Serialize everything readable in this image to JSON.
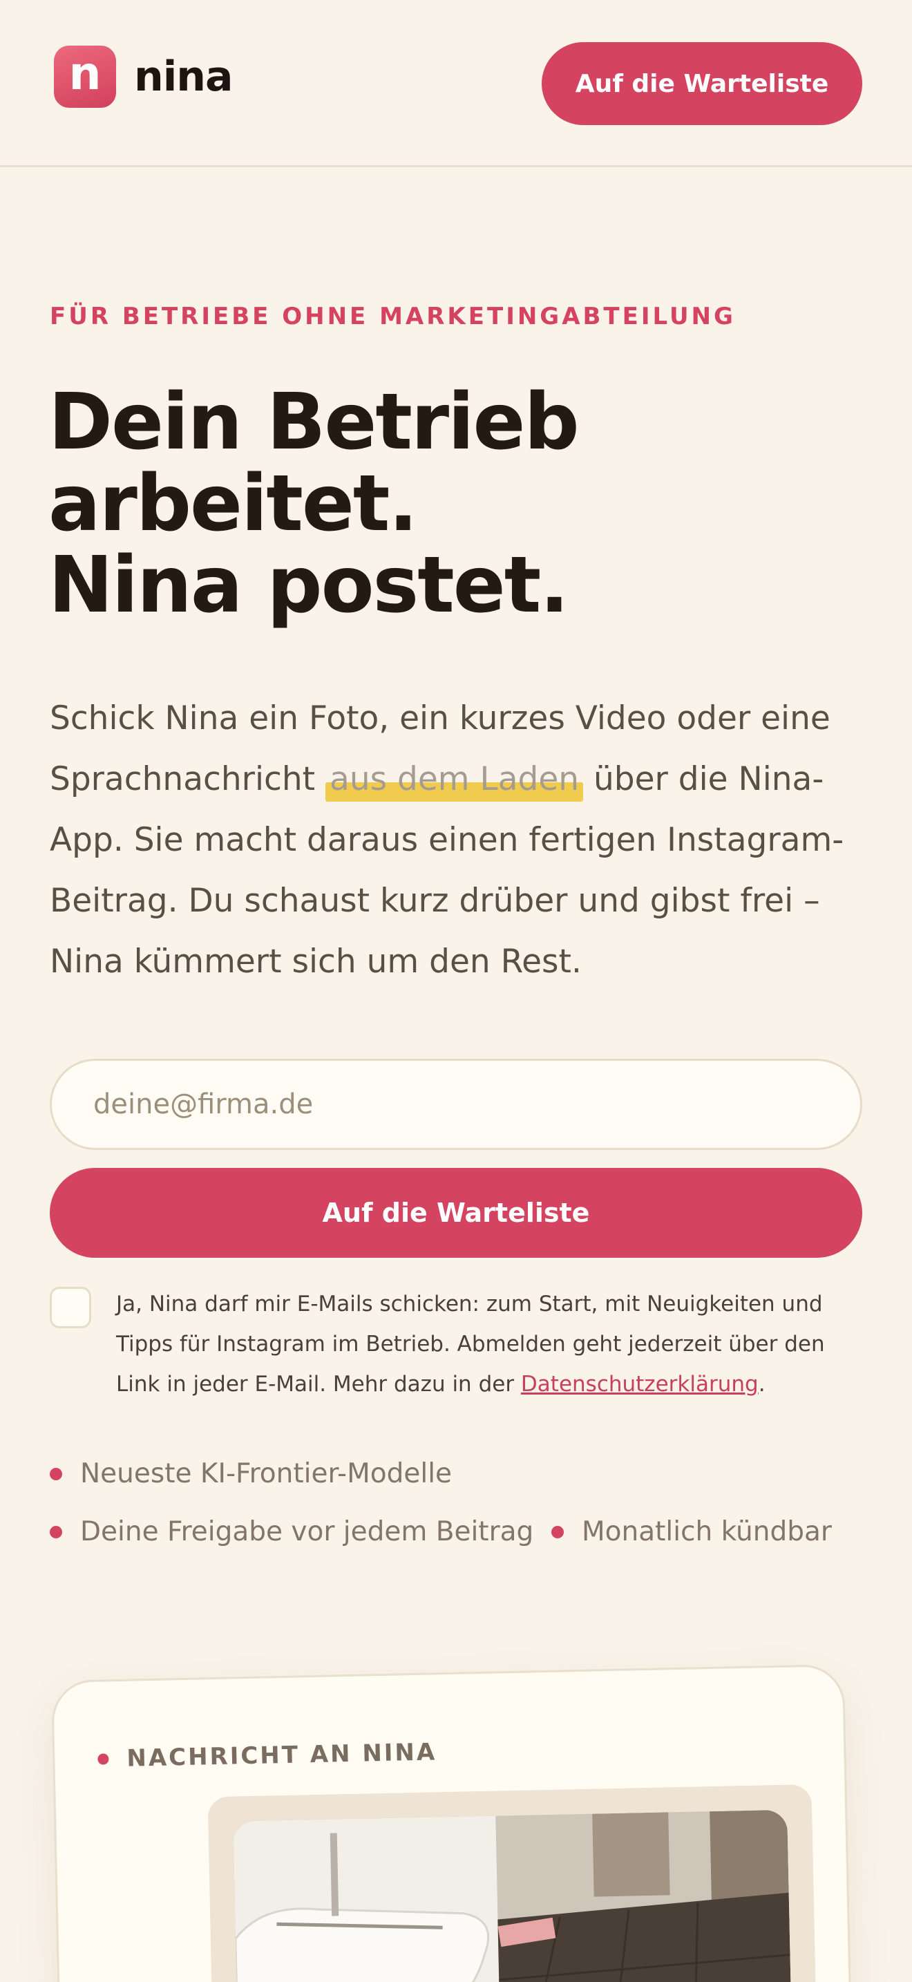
{
  "header": {
    "logo_letter": "n",
    "logo_text": "nina",
    "cta_label": "Auf die Warteliste"
  },
  "hero": {
    "eyebrow": "FÜR BETRIEBE OHNE MARKETINGABTEILUNG",
    "headline": [
      "Dein Betrieb",
      "arbeitet.",
      "Nina postet."
    ],
    "lede_before": "Schick Nina ein Foto, ein kurzes Video oder eine Sprachnachricht ",
    "lede_highlight": "aus dem Laden",
    "lede_after": " über die Nina-App. Sie macht daraus einen fertigen Instagram-Beitrag. Du schaust kurz drüber und gibst frei – Nina kümmert sich um den Rest."
  },
  "signup": {
    "email_placeholder": "deine@firma.de",
    "email_value": "",
    "submit_label": "Auf die Warteliste",
    "consent_text": "Ja, Nina darf mir E-Mails schicken: zum Start, mit Neuigkeiten und Tipps für Instagram im Betrieb. Abmelden geht jederzeit über den Link in jeder E-Mail. Mehr dazu in der ",
    "consent_link": "Datenschutzerklärung",
    "consent_end": "."
  },
  "features": [
    "Neueste KI-Frontier-Modelle",
    "Deine Freigabe vor jedem Beitrag",
    "Monatlich kündbar"
  ],
  "card": {
    "label": "NACHRICHT AN NINA"
  },
  "colors": {
    "background": "#f9f3ea",
    "accent": "#d4435f",
    "highlight": "#f1cb4e",
    "text": "#241a13"
  }
}
